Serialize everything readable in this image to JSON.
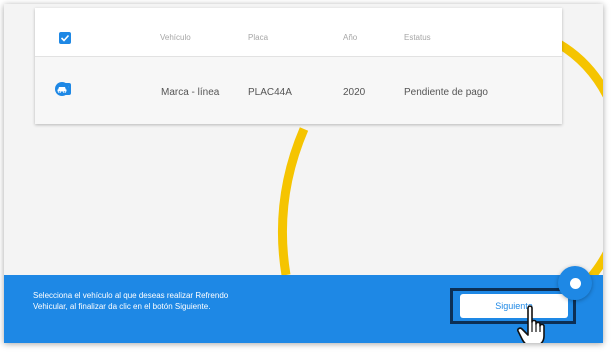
{
  "table": {
    "headers": [
      "Vehículo",
      "Placa",
      "Año",
      "Estatus"
    ],
    "row": {
      "vehiculo": "Marca - línea",
      "placa": "PLAC44A",
      "anio": "2020",
      "estatus": "Pendiente de pago"
    }
  },
  "banner": {
    "instruction": "Selecciona el vehículo al que deseas realizar Refrendo Vehicular, al finalizar da clic en el botón Siguiente.",
    "next_label": "Siguiente"
  },
  "colors": {
    "accent": "#1e88e5",
    "decor": "#f5c400",
    "highlight_box": "#0c2f55"
  },
  "icons": [
    "check-icon",
    "car-icon",
    "chat-icon",
    "hand-pointer-icon"
  ]
}
